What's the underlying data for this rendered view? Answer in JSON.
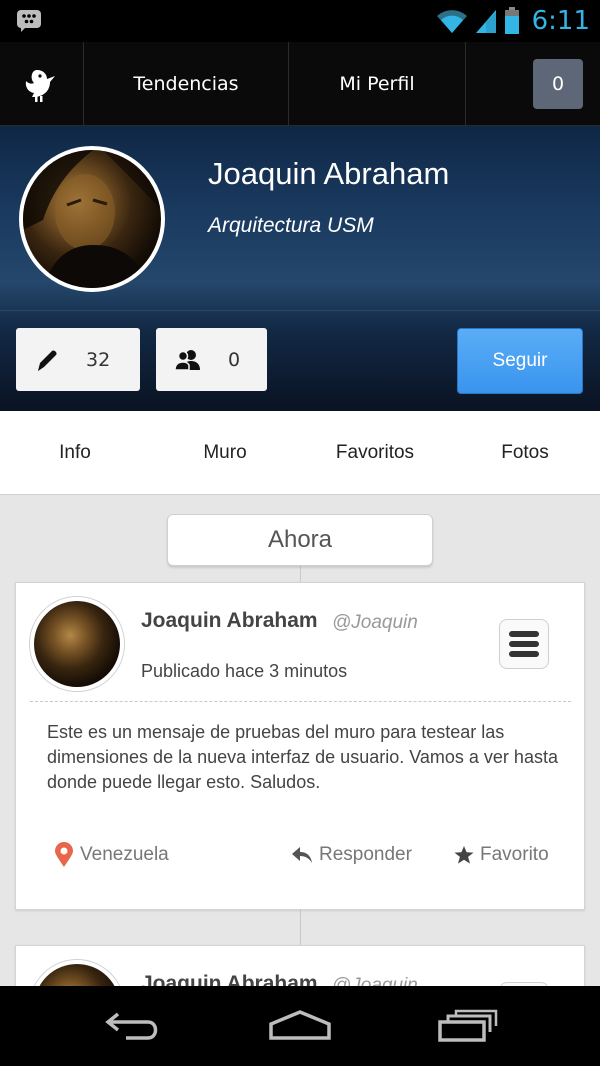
{
  "status_bar": {
    "time": "6:11",
    "icons": [
      "bbm-icon",
      "wifi-icon",
      "signal-icon",
      "battery-icon"
    ]
  },
  "action_bar": {
    "logo_icon": "bird-icon",
    "tabs": [
      {
        "label": "Tendencias"
      },
      {
        "label": "Mi Perfil"
      }
    ],
    "notification_count": "0"
  },
  "profile": {
    "name": "Joaquin Abraham",
    "subtitle": "Arquitectura USM",
    "stats": [
      {
        "icon": "pencil-icon",
        "value": "32"
      },
      {
        "icon": "users-icon",
        "value": "0"
      }
    ],
    "follow_label": "Seguir",
    "accent_color": "#3a94ee"
  },
  "profile_tabs": [
    {
      "label": "Info"
    },
    {
      "label": "Muro"
    },
    {
      "label": "Favoritos"
    },
    {
      "label": "Fotos"
    }
  ],
  "timeline": {
    "time_label": "Ahora",
    "posts": [
      {
        "author": "Joaquin Abraham",
        "handle": "@Joaquin",
        "published": "Publicado hace 3 minutos",
        "body": "Este es un mensaje de pruebas del muro para testear las dimensiones de la nueva interfaz de usuario. Vamos a ver hasta donde puede llegar esto. Saludos.",
        "location": "Venezuela",
        "reply_label": "Responder",
        "favorite_label": "Favorito"
      },
      {
        "author": "Joaquin Abraham",
        "handle": "@Joaquin"
      }
    ]
  },
  "nav_bar": {
    "icons": [
      "back-icon",
      "home-icon",
      "recent-apps-icon"
    ]
  }
}
